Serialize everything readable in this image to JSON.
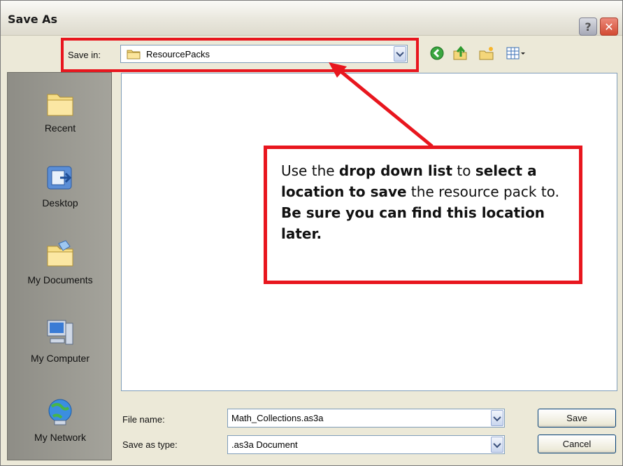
{
  "window": {
    "title": "Save As",
    "help_glyph": "?",
    "close_glyph": "✕"
  },
  "toolbar": {
    "save_in_label": "Save in:",
    "save_in_value": "ResourcePacks",
    "icons": [
      "back-icon",
      "up-folder-icon",
      "new-folder-icon",
      "views-menu-icon"
    ]
  },
  "places": [
    {
      "label": "Recent",
      "icon": "recent-folder-icon"
    },
    {
      "label": "Desktop",
      "icon": "desktop-icon"
    },
    {
      "label": "My Documents",
      "icon": "my-documents-icon"
    },
    {
      "label": "My Computer",
      "icon": "my-computer-icon"
    },
    {
      "label": "My Network",
      "icon": "my-network-icon"
    }
  ],
  "form": {
    "file_name_label": "File name:",
    "file_name_value": "Math_Collections.as3a",
    "save_type_label": "Save as type:",
    "save_type_value": ".as3a Document"
  },
  "buttons": {
    "save": "Save",
    "cancel": "Cancel"
  },
  "annotation": {
    "p1": "Use the ",
    "b1": "drop down list",
    "p2": " to ",
    "b2": "select a location to save",
    "p3": " the resource pack to. ",
    "b3": "Be sure you can find this location later."
  },
  "colors": {
    "highlight": "#e8161e",
    "dialog_bg": "#ece9d8",
    "input_border": "#7f9db9"
  }
}
